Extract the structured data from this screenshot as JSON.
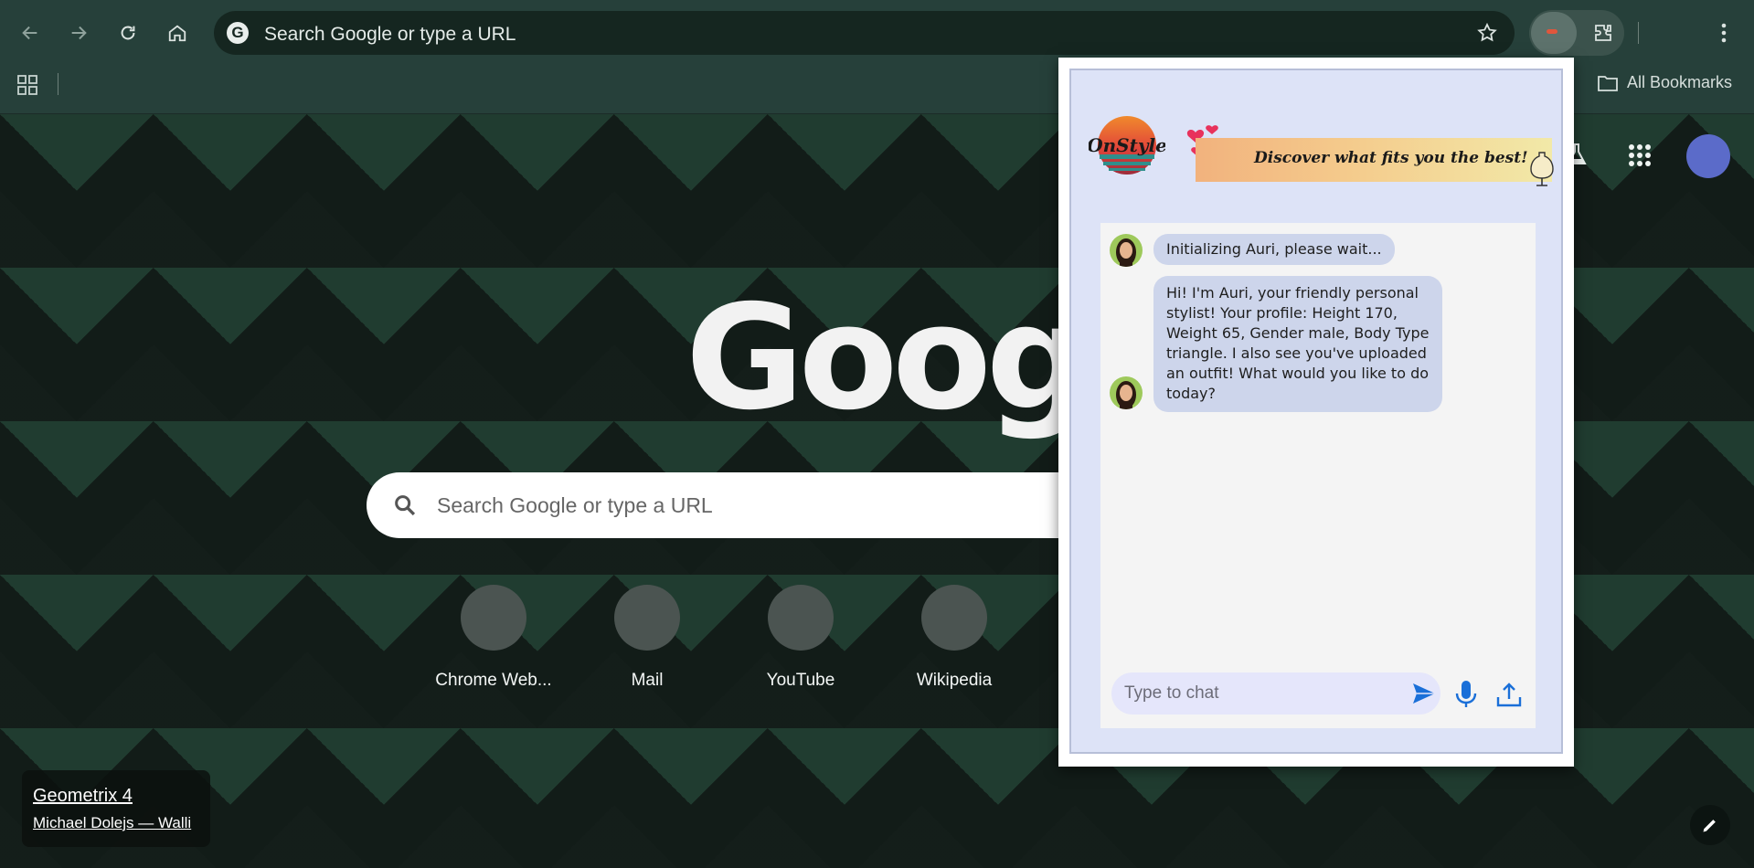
{
  "browser": {
    "omnibox_placeholder": "Search Google or type a URL",
    "omnibox_g": "G",
    "all_bookmarks_label": "All Bookmarks"
  },
  "ntp": {
    "logo_text": "Google",
    "search_placeholder": "Search Google or type a URL",
    "shortcuts": [
      {
        "label": "Chrome Web..."
      },
      {
        "label": "Mail"
      },
      {
        "label": "YouTube"
      },
      {
        "label": "Wikipedia"
      }
    ],
    "attribution": {
      "title": "Geometrix 4",
      "author": "Michael Dolejs — Walli"
    }
  },
  "popup": {
    "logo_text": "OnStyle",
    "banner_text": "Discover what fits you the best!",
    "messages": [
      {
        "sender": "bot",
        "text": "Initializing Auri, please wait..."
      },
      {
        "sender": "bot",
        "text": "Hi! I'm Auri, your friendly personal stylist! Your profile: Height 170, Weight 65, Gender male, Body Type triangle. I also see you've uploaded an outfit! What would you like to do today?"
      }
    ],
    "input_placeholder": "Type to chat"
  },
  "colors": {
    "chrome_bg": "#26403a",
    "omnibox_bg": "#152620",
    "popup_bg": "#dde3f7",
    "bubble_bg": "#cdd5eb",
    "send_blue": "#1a6fd8",
    "avatar_blue": "#5b6bc9"
  }
}
